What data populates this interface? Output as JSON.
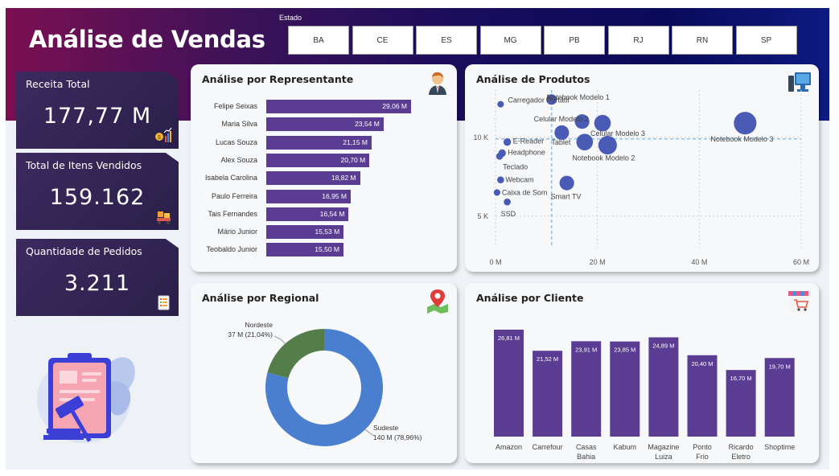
{
  "header": {
    "title": "Análise de Vendas",
    "estado_label": "Estado",
    "states": [
      "BA",
      "CE",
      "ES",
      "MG",
      "PB",
      "RJ",
      "RN",
      "SP"
    ]
  },
  "kpis": [
    {
      "label": "Receita Total",
      "value": "177,77 M",
      "icon": "money-chart-icon"
    },
    {
      "label": "Total de Itens Vendidos",
      "value": "159.162",
      "icon": "boxes-cart-icon"
    },
    {
      "label": "Quantidade de Pedidos",
      "value": "3.211",
      "icon": "order-list-icon"
    }
  ],
  "representante": {
    "title": "Análise por Representante",
    "icon": "salesman-icon",
    "rows": [
      {
        "name": "Felipe Seixas",
        "value": 29.06,
        "label": "29,06 M"
      },
      {
        "name": "Maria Silva",
        "value": 23.54,
        "label": "23,54 M"
      },
      {
        "name": "Lucas Souza",
        "value": 21.15,
        "label": "21,15 M"
      },
      {
        "name": "Alex Souza",
        "value": 20.7,
        "label": "20,70 M"
      },
      {
        "name": "Isabela Carolina",
        "value": 18.82,
        "label": "18,82 M"
      },
      {
        "name": "Paulo Ferreira",
        "value": 16.95,
        "label": "16,95 M"
      },
      {
        "name": "Tais Fernandes",
        "value": 16.54,
        "label": "16,54 M"
      },
      {
        "name": "Mário Junior",
        "value": 15.53,
        "label": "15,53 M"
      },
      {
        "name": "Teobaldo Junior",
        "value": 15.5,
        "label": "15,50 M"
      }
    ]
  },
  "produtos": {
    "title": "Análise de Produtos",
    "icon": "computer-icon",
    "x_ticks": [
      "0 M",
      "20 M",
      "40 M",
      "60 M"
    ],
    "y_ticks": [
      "5 K",
      "10 K"
    ]
  },
  "regional": {
    "title": "Análise por Regional",
    "icon": "map-pin-icon",
    "nordeste_name": "Nordeste",
    "nordeste_value": "37 M (21,04%)",
    "sudeste_name": "Sudeste",
    "sudeste_value": "140 M (78,96%)"
  },
  "cliente": {
    "title": "Análise por Cliente",
    "icon": "store-cart-icon"
  },
  "colors": {
    "purple": "#5a3d92",
    "blue": "#4a5bb5",
    "donut_blue": "#4a7fcf",
    "donut_green": "#547d4a"
  },
  "chart_data": [
    {
      "type": "bar",
      "title": "Análise por Representante",
      "categories": [
        "Felipe Seixas",
        "Maria Silva",
        "Lucas Souza",
        "Alex Souza",
        "Isabela Carolina",
        "Paulo Ferreira",
        "Tais Fernandes",
        "Mário Junior",
        "Teobaldo Junior"
      ],
      "values": [
        29.06,
        23.54,
        21.15,
        20.7,
        18.82,
        16.95,
        16.54,
        15.53,
        15.5
      ]
    },
    {
      "type": "scatter",
      "title": "Análise de Produtos",
      "xlim": [
        0,
        60
      ],
      "ylim": [
        3,
        13
      ],
      "points": [
        {
          "label": "Carregador Portátil",
          "x": 1,
          "y": 12.1,
          "size": 1
        },
        {
          "label": "Notebook Modelo 1",
          "x": 11,
          "y": 12.4,
          "size": 3
        },
        {
          "label": "Celular Modelo 2",
          "x": 17,
          "y": 11.0,
          "size": 5
        },
        {
          "label": "Celular Modelo 3",
          "x": 21,
          "y": 10.9,
          "size": 6
        },
        {
          "label": "Notebook Modelo 3",
          "x": 49,
          "y": 10.9,
          "size": 9
        },
        {
          "label": "Tablet",
          "x": 13,
          "y": 10.3,
          "size": 5
        },
        {
          "label": "",
          "x": 17.5,
          "y": 9.7,
          "size": 6
        },
        {
          "label": "Notebook Modelo 2",
          "x": 22,
          "y": 9.5,
          "size": 7
        },
        {
          "label": "E-Reader",
          "x": 2.3,
          "y": 9.7,
          "size": 1.5
        },
        {
          "label": "Headphone",
          "x": 1.3,
          "y": 9.0,
          "size": 1.5
        },
        {
          "label": "Teclado",
          "x": 0.8,
          "y": 8.8,
          "size": 1.2
        },
        {
          "label": "Webcam",
          "x": 1,
          "y": 7.3,
          "size": 1.2
        },
        {
          "label": "Smart TV",
          "x": 14,
          "y": 7.1,
          "size": 5
        },
        {
          "label": "Caixa de Som",
          "x": 0.3,
          "y": 6.5,
          "size": 1
        },
        {
          "label": "SSD",
          "x": 2.3,
          "y": 5.9,
          "size": 1.2
        }
      ],
      "ref_x": 11,
      "ref_y": 9.9
    },
    {
      "type": "pie",
      "title": "Análise por Regional",
      "categories": [
        "Sudeste",
        "Nordeste"
      ],
      "values": [
        140,
        37
      ],
      "percent": [
        78.96,
        21.04
      ]
    },
    {
      "type": "bar",
      "title": "Análise por Cliente",
      "categories": [
        "Amazon",
        "Carrefour",
        "Casas Bahia",
        "Kabum",
        "Magazine Luiza",
        "Ponto Frio",
        "Ricardo Eletro",
        "Shoptime"
      ],
      "values": [
        26.81,
        21.52,
        23.91,
        23.85,
        24.89,
        20.4,
        16.7,
        19.7
      ],
      "value_labels": [
        "26,81 M",
        "21,52 M",
        "23,91 M",
        "23,85 M",
        "24,89 M",
        "20,40 M",
        "16,70 M",
        "19,70 M"
      ]
    }
  ]
}
